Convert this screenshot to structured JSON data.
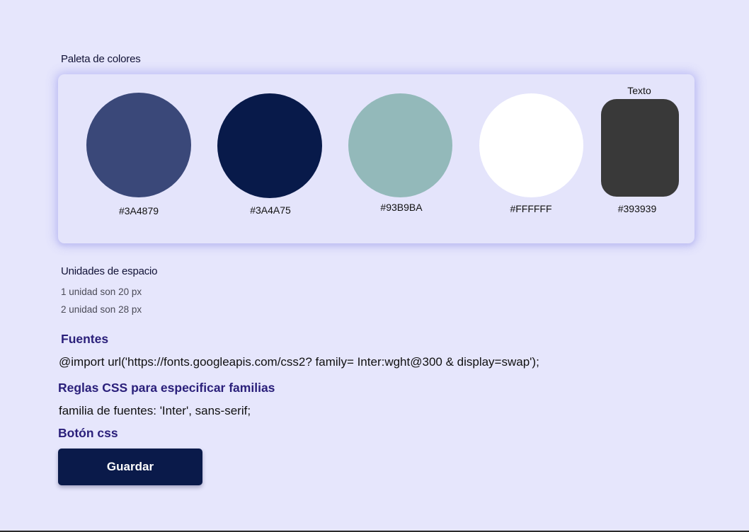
{
  "palette": {
    "title": "Paleta de colores",
    "swatches": [
      {
        "hex": "#3A4879",
        "fill": "#3a4879",
        "label": "#3A4879"
      },
      {
        "hex": "#3A4A75",
        "fill": "#081a4a",
        "label": "#3A4A75"
      },
      {
        "hex": "#93B9BA",
        "fill": "#93b9ba",
        "label": "#93B9BA"
      },
      {
        "hex": "#FFFFFF",
        "fill": "#ffffff",
        "label": "#FFFFFF"
      }
    ],
    "text_swatch": {
      "caption": "Texto",
      "fill": "#393939",
      "label": "#393939"
    }
  },
  "spacing": {
    "title": "Unidades de espacio",
    "lines": [
      "1 unidad son 20 px",
      "2 unidad son 28 px"
    ]
  },
  "fonts": {
    "title": "Fuentes",
    "import_line": "@import url('https://fonts.googleapis.com/css2? family= Inter:wght@300 & display=swap');"
  },
  "css_rules": {
    "title": "Reglas CSS para especificar familias",
    "line": "familia de fuentes: 'Inter', sans-serif;"
  },
  "button_css": {
    "title": "Botón css",
    "button_label": "Guardar",
    "button_color": "#0a1a4a"
  },
  "colors": {
    "background": "#e6e6fc",
    "accent_title": "#2a1f7a"
  }
}
